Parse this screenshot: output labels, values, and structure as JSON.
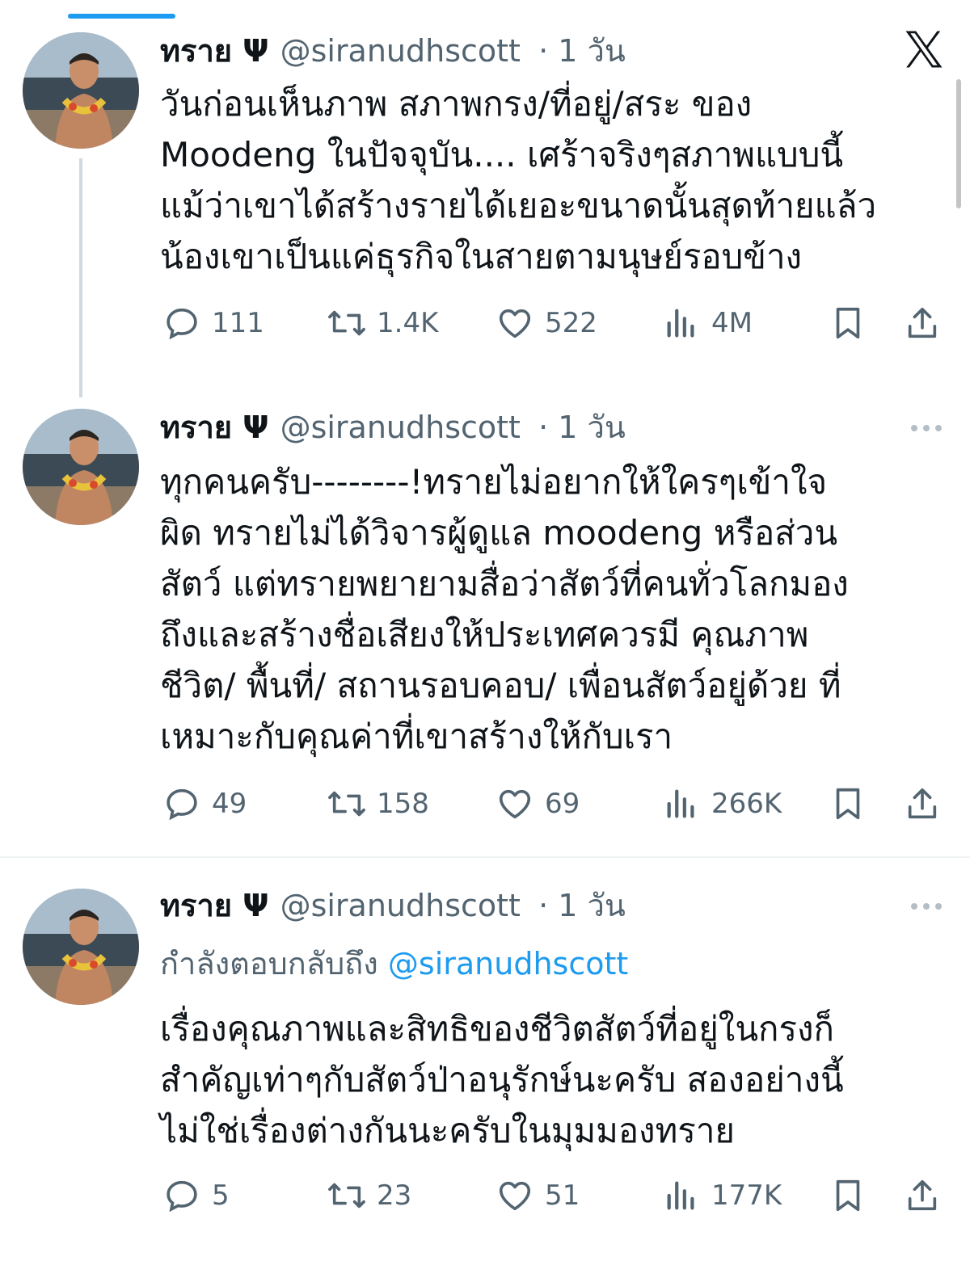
{
  "tweets": [
    {
      "name": "ทราย Ψ",
      "handle": "@siranudhscott",
      "time": "· 1 วัน",
      "lines": [
        "วันก่อนเห็นภาพ สภาพกรง/ที่อยู่/สระ ของ",
        "Moodeng ในปัจจุบัน.... เศร้าจริงๆสภาพแบบนี้",
        "แม้ว่าเขาได้สร้างรายได้เยอะขนาดนั้นสุดท้ายแล้ว",
        "น้องเขาเป็นแค่ธุรกิจในสายตามนุษย์รอบข้าง"
      ],
      "stats": {
        "replies": "111",
        "reposts": "1.4K",
        "likes": "522",
        "views": "4M"
      }
    },
    {
      "name": "ทราย Ψ",
      "handle": "@siranudhscott",
      "time": "· 1 วัน",
      "lines": [
        "ทุกคนครับ--------!ทรายไม่อยากให้ใครๆเข้าใจ",
        "ผิด ทรายไม่ได้วิจารผู้ดูแล moodeng หรือส่วน",
        "สัตว์ แต่ทรายพยายามสื่อว่าสัตว์ที่คนทั่วโลกมอง",
        "ถึงและสร้างชื่อเสียงให้ประเทศควรมี คุณภาพ",
        "ชีวิต/ พื้นที่/ สถานรอบคอบ/ เพื่อนสัตว์อยู่ด้วย ที่",
        "เหมาะกับคุณค่าที่เขาสร้างให้กับเรา"
      ],
      "stats": {
        "replies": "49",
        "reposts": "158",
        "likes": "69",
        "views": "266K"
      }
    },
    {
      "name": "ทราย Ψ",
      "handle": "@siranudhscott",
      "time": "· 1 วัน",
      "replying_prefix": "กำลังตอบกลับถึง",
      "replying_to": "@siranudhscott",
      "lines": [
        "เรื่องคุณภาพและสิทธิของชีวิตสัตว์ที่อยู่ในกรงก็",
        "สำคัญเท่าๆกับสัตว์ป่าอนุรักษ์นะครับ สองอย่างนี้",
        "ไม่ใช่เรื่องต่างกันนะครับในมุมมองทราย"
      ],
      "stats": {
        "replies": "5",
        "reposts": "23",
        "likes": "51",
        "views": "177K"
      }
    }
  ],
  "icons": {
    "close": "x-logo-icon",
    "reply": "reply-bubble-icon",
    "repost": "repost-icon",
    "like": "heart-icon",
    "views": "views-bar-icon",
    "bookmark": "bookmark-icon",
    "share": "share-icon",
    "more": "more-dots-icon"
  },
  "colors": {
    "accent": "#1d9bf0",
    "text": "#0f1419",
    "secondary": "#536471",
    "divider": "#eff3f4"
  }
}
